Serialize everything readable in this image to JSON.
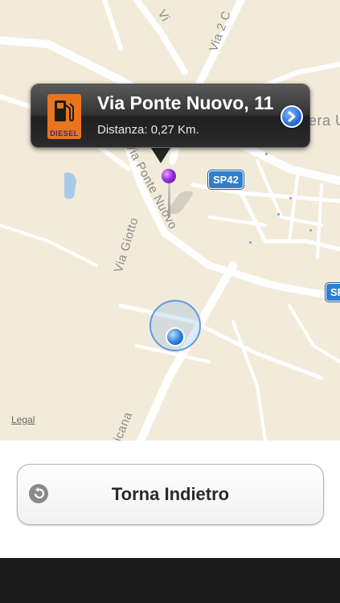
{
  "map": {
    "road_labels": {
      "via_2": "Via 2 C",
      "via_giotto": "Via Giotto",
      "via_ponte_nuovo": "Via Ponte Nuovo",
      "road_bottom": "icana",
      "area_right": "era U",
      "road_top": "Vi"
    },
    "shields": {
      "sp42_a": "SP42",
      "sp42_b": "SP"
    },
    "legal": "Legal"
  },
  "callout": {
    "title": "Via Ponte Nuovo, 11",
    "subtitle": "Distanza: 0,27 Km.",
    "icon_text": "DIESEL",
    "icon_name": "fuel-pump-icon"
  },
  "back_button": {
    "label": "Torna Indietro",
    "icon_name": "back-arrow-icon"
  },
  "colors": {
    "map_background": "#f2ebd9",
    "shield_blue": "#2f7fd1",
    "pin_purple": "#9b2ee0",
    "location_blue": "#2d7de0",
    "icon_orange": "#e8751e"
  }
}
